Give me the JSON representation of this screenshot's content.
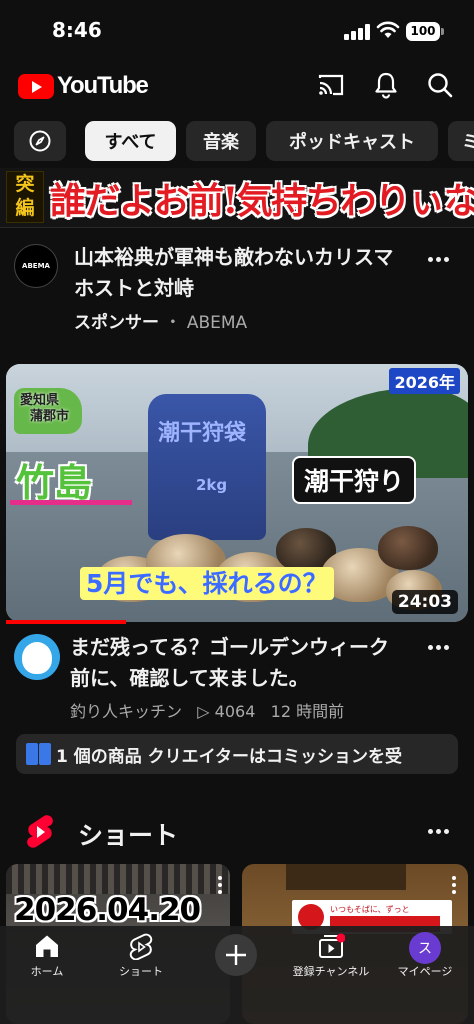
{
  "status_bar": {
    "time": "8:46",
    "battery": "100"
  },
  "header": {
    "logo_text": "YouTube"
  },
  "chips": {
    "items": [
      {
        "label": "すべて"
      },
      {
        "label": "音楽"
      },
      {
        "label": "ポッドキャスト"
      },
      {
        "label": "ミ"
      }
    ]
  },
  "ad_banner": {
    "tag": "突編",
    "headline": "誰だよお前!気持ちわりぃな!"
  },
  "sponsor": {
    "avatar_text": "ABEMA",
    "title": "山本裕典が軍神も敵わないカリスマホストと対峙",
    "label": "スポンサー",
    "separator": "・",
    "advertiser": "ABEMA"
  },
  "video": {
    "thumbnail": {
      "year": "2026年",
      "prefecture": "愛知県",
      "city": "蒲郡市",
      "place": "竹島",
      "activity": "潮干狩り",
      "question": "5月でも、採れるの？",
      "bag_text": "潮干狩袋",
      "bag_weight": "2kg"
    },
    "duration": "24:03",
    "progress_fraction": 0.26,
    "title": "まだ残ってる？ゴールデンウィーク前に、確認して来ました。",
    "channel": "釣り人キッチン",
    "views": "▷ 4064",
    "age": "12 時間前"
  },
  "shopping": {
    "text": "1 個の商品  クリエイターはコミッションを受"
  },
  "shorts": {
    "title": "ショート",
    "cards": [
      {
        "overlay": "2026.04.20"
      },
      {
        "overlay": "いつもそばに、ずっと"
      }
    ]
  },
  "bottom_nav": {
    "items": [
      {
        "label": "ホーム"
      },
      {
        "label": "ショート"
      },
      {
        "label": "登録チャンネル"
      },
      {
        "label": "マイページ"
      }
    ],
    "avatar_initial": "ス"
  },
  "colors": {
    "brand_red": "#ff0000",
    "background": "#0f0f0f",
    "chip": "#272727"
  }
}
